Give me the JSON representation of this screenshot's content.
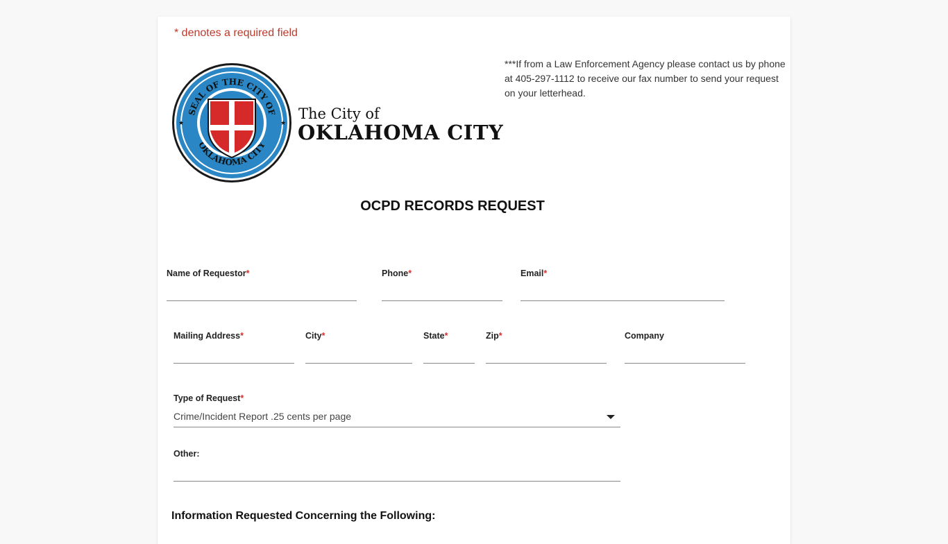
{
  "required_note": "* denotes a required field",
  "logo": {
    "line1": "The City of",
    "line2": "OKLAHOMA CITY",
    "seal_text_top": "SEAL OF THE CITY OF",
    "seal_text_bottom": "OKLAHOMA CITY"
  },
  "law_enforcement_note": "***If from a Law Enforcement Agency please contact us by phone at 405-297-1112 to receive our fax number to send your request on your letterhead.",
  "form_title": "OCPD RECORDS REQUEST",
  "required_marker": "*",
  "fields": {
    "name": {
      "label": "Name of Requestor",
      "value": ""
    },
    "phone": {
      "label": "Phone",
      "value": ""
    },
    "email": {
      "label": "Email",
      "value": ""
    },
    "mailing_address": {
      "label": "Mailing Address",
      "value": ""
    },
    "city": {
      "label": "City",
      "value": ""
    },
    "state": {
      "label": "State",
      "value": ""
    },
    "zip": {
      "label": "Zip",
      "value": ""
    },
    "company": {
      "label": "Company",
      "value": ""
    },
    "type_of_request": {
      "label": "Type of Request",
      "selected": "Crime/Incident Report .25 cents per page"
    },
    "other": {
      "label": "Other:",
      "value": ""
    }
  },
  "section_title": "Information Requested Concerning the Following:",
  "colors": {
    "required": "#d32f2f",
    "seal_blue": "#2a86c4",
    "seal_red": "#d62a2a"
  }
}
